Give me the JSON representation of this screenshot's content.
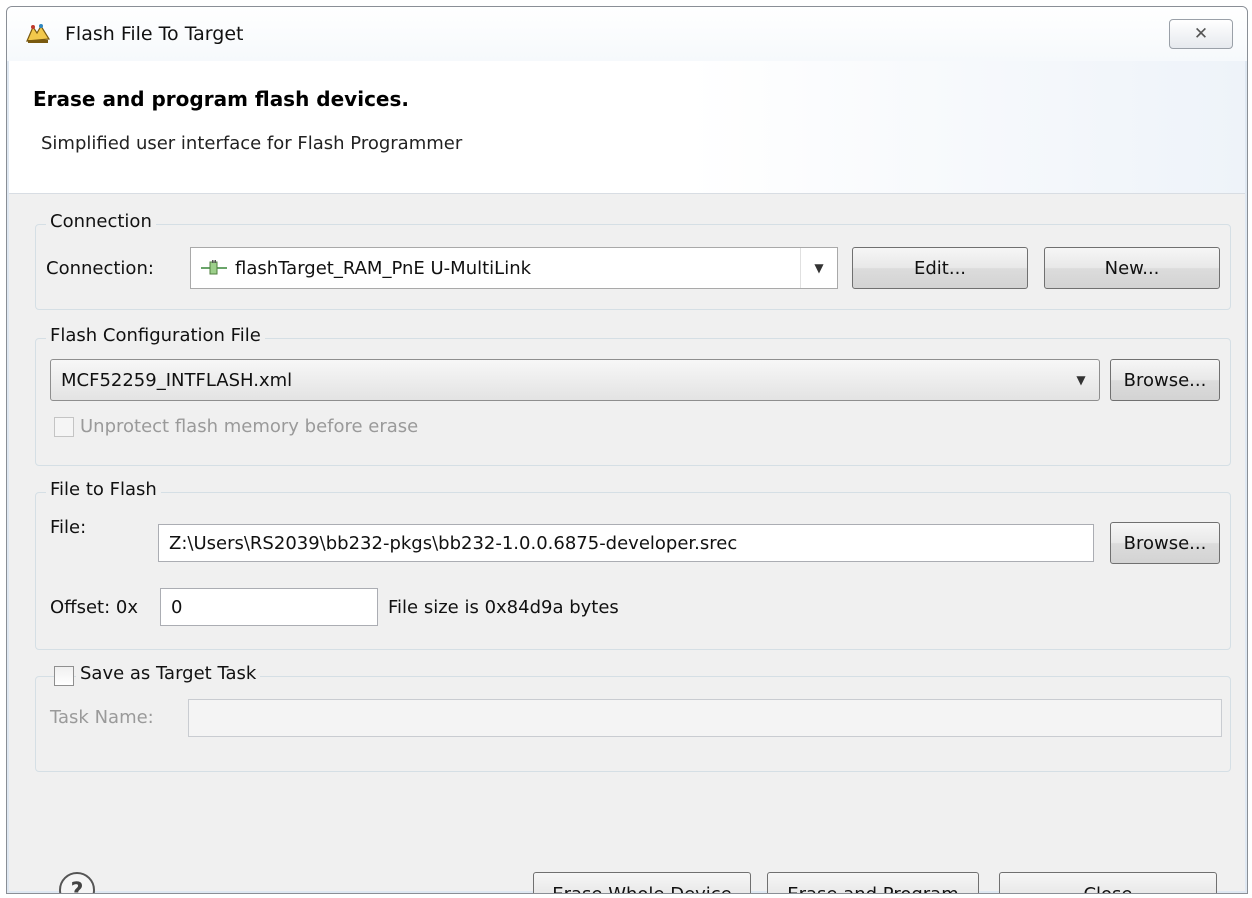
{
  "window": {
    "title": "Flash File To Target",
    "close_glyph": "✕"
  },
  "banner": {
    "title": "Erase and program flash devices.",
    "subtitle": "Simplified user interface for Flash Programmer"
  },
  "connection_group": {
    "legend": "Connection",
    "label": "Connection:",
    "selected": "flashTarget_RAM_PnE U-MultiLink",
    "edit_label": "Edit...",
    "new_label": "New..."
  },
  "flash_config_group": {
    "legend": "Flash Configuration File",
    "selected": "MCF52259_INTFLASH.xml",
    "browse_label": "Browse...",
    "unprotect_label": "Unprotect flash memory before erase"
  },
  "file_group": {
    "legend": "File to Flash",
    "file_label": "File:",
    "file_value": "Z:\\Users\\RS2039\\bb232-pkgs\\bb232-1.0.0.6875-developer.srec",
    "browse_label": "Browse...",
    "offset_label": "Offset: 0x",
    "offset_value": "0",
    "file_size_text": "File size is 0x84d9a bytes"
  },
  "target_task_group": {
    "legend": "Save as Target Task",
    "task_name_label": "Task Name:",
    "task_name_value": ""
  },
  "footer": {
    "erase_whole_label": "Erase Whole Device",
    "erase_program_label": "Erase and Program",
    "close_label": "Close"
  },
  "icons": {
    "title": "flash-programmer-icon",
    "connection": "connection-plug-icon",
    "help": "help-icon"
  }
}
